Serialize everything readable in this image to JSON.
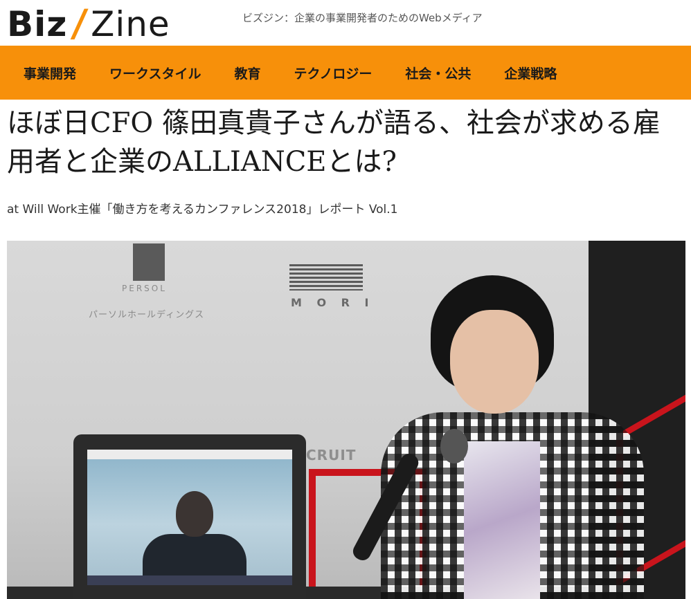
{
  "header": {
    "logo_biz": "Biz",
    "logo_slash": "/",
    "logo_zine": "Zine",
    "tagline": "ビズジン：企業の事業開発者のためのWebメディア"
  },
  "nav": {
    "items": [
      {
        "label": "事業開発"
      },
      {
        "label": "ワークスタイル"
      },
      {
        "label": "教育"
      },
      {
        "label": "テクノロジー"
      },
      {
        "label": "社会・公共"
      },
      {
        "label": "企業戦略"
      }
    ]
  },
  "article": {
    "title": "ほぼ日CFO 篠田真貴子さんが語る、社会が求める雇用者と企業のALLIANCEとは?",
    "subtitle": "at Will Work主催「働き方を考えるカンファレンス2018」レポート Vol.1"
  },
  "photo": {
    "sponsor_persol": "PERSOL",
    "sponsor_persol_jp": "パーソルホールディングス",
    "sponsor_mori": "M O R I",
    "sponsor_recruit": "CRUIT"
  },
  "colors": {
    "accent": "#f7900a",
    "text": "#1a1a1a"
  }
}
